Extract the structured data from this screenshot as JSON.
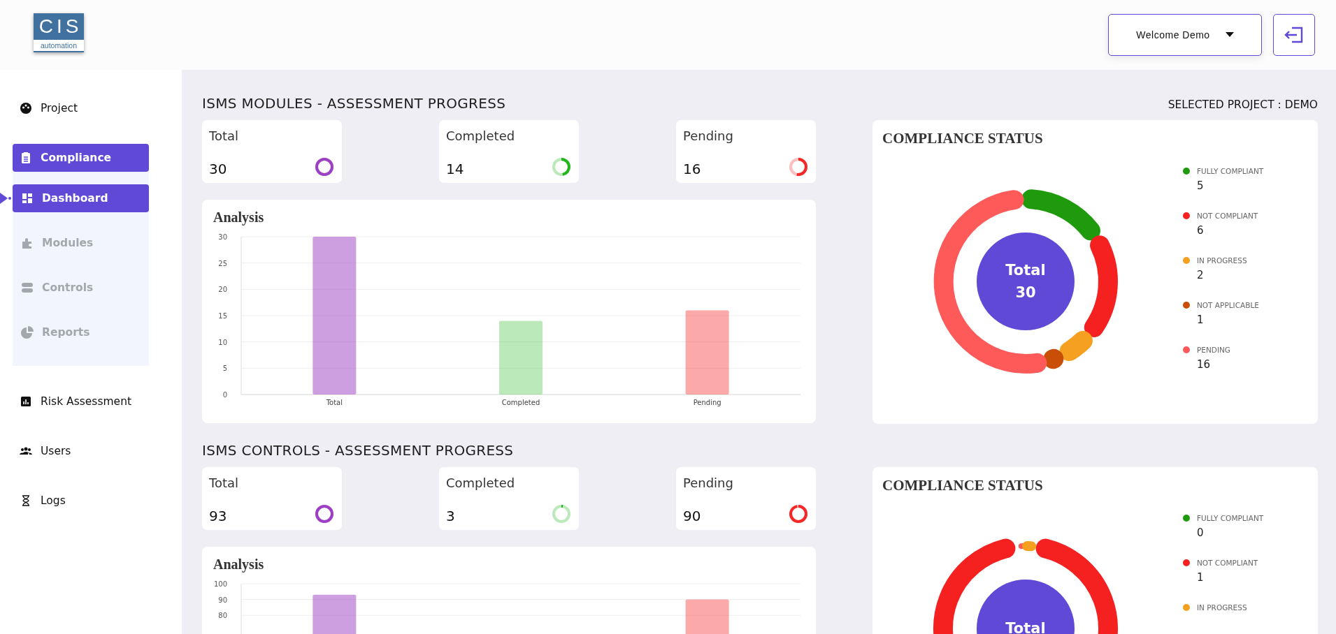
{
  "header": {
    "logo": {
      "title": "CIS",
      "subtitle": "automation"
    },
    "user_menu": {
      "label": "Welcome Demo"
    }
  },
  "sidebar": {
    "items": [
      {
        "label": "Project",
        "selected": false
      },
      {
        "label": "Compliance",
        "selected": true,
        "expanded": true,
        "children": [
          {
            "label": "Dashboard",
            "selected": true
          },
          {
            "label": "Modules",
            "selected": false
          },
          {
            "label": "Controls",
            "selected": false
          },
          {
            "label": "Reports",
            "selected": false
          }
        ]
      },
      {
        "label": "Risk Assessment",
        "selected": false
      },
      {
        "label": "Users",
        "selected": false
      },
      {
        "label": "Logs",
        "selected": false
      }
    ]
  },
  "selected_project": "SELECTED PROJECT : DEMO",
  "sections": [
    {
      "title": "ISMS MODULES - ASSESSMENT PROGRESS",
      "stats": [
        {
          "label": "Total",
          "value": "30",
          "level": 1,
          "color": "#9c3fc4"
        },
        {
          "label": "Completed",
          "value": "14",
          "level": 0.47,
          "color": "#22b51c"
        },
        {
          "label": "Pending",
          "value": "16",
          "level": 0.53,
          "color": "#f52828"
        }
      ],
      "analysis": {
        "title": "Analysis",
        "chart_data": {
          "type": "bar",
          "categories": [
            "Total",
            "Completed",
            "Pending"
          ],
          "values": [
            30,
            14,
            16
          ],
          "ylim": [
            0,
            30
          ],
          "yticks": [
            0,
            5,
            10,
            15,
            20,
            25,
            30
          ],
          "grid": true
        }
      },
      "compliance": {
        "title": "COMPLIANCE STATUS",
        "center_label": "Total",
        "center_value": "30",
        "legend": [
          {
            "label": "FULLY COMPLIANT",
            "value": "5",
            "color": "#1f9a0c"
          },
          {
            "label": "NOT COMPLIANT",
            "value": "6",
            "color": "#f52020"
          },
          {
            "label": "IN PROGRESS",
            "value": "2",
            "color": "#f5a020"
          },
          {
            "label": "NOT APPLICABLE",
            "value": "1",
            "color": "#c94f08"
          },
          {
            "label": "PENDING",
            "value": "16",
            "color": "#ff5a5a"
          }
        ]
      }
    },
    {
      "title": "ISMS CONTROLS - ASSESSMENT PROGRESS",
      "stats": [
        {
          "label": "Total",
          "value": "93",
          "level": 1,
          "color": "#9c3fc4"
        },
        {
          "label": "Completed",
          "value": "3",
          "level": 0.03,
          "color": "#22b51c"
        },
        {
          "label": "Pending",
          "value": "90",
          "level": 0.97,
          "color": "#f52828"
        }
      ],
      "analysis": {
        "title": "Analysis",
        "chart_data": {
          "type": "bar",
          "values": [
            93,
            null,
            90
          ],
          "ylim": [
            0,
            100
          ],
          "yticks": [
            80,
            90,
            100
          ],
          "grid": true
        }
      },
      "compliance": {
        "title": "COMPLIANCE STATUS",
        "center_label": "Total",
        "legend": [
          {
            "label": "FULLY COMPLIANT",
            "value": "0",
            "color": "#1f9a0c"
          },
          {
            "label": "NOT COMPLIANT",
            "value": "1",
            "color": "#f52020"
          },
          {
            "label": "IN PROGRESS",
            "color": "#f5a020"
          }
        ]
      }
    }
  ]
}
